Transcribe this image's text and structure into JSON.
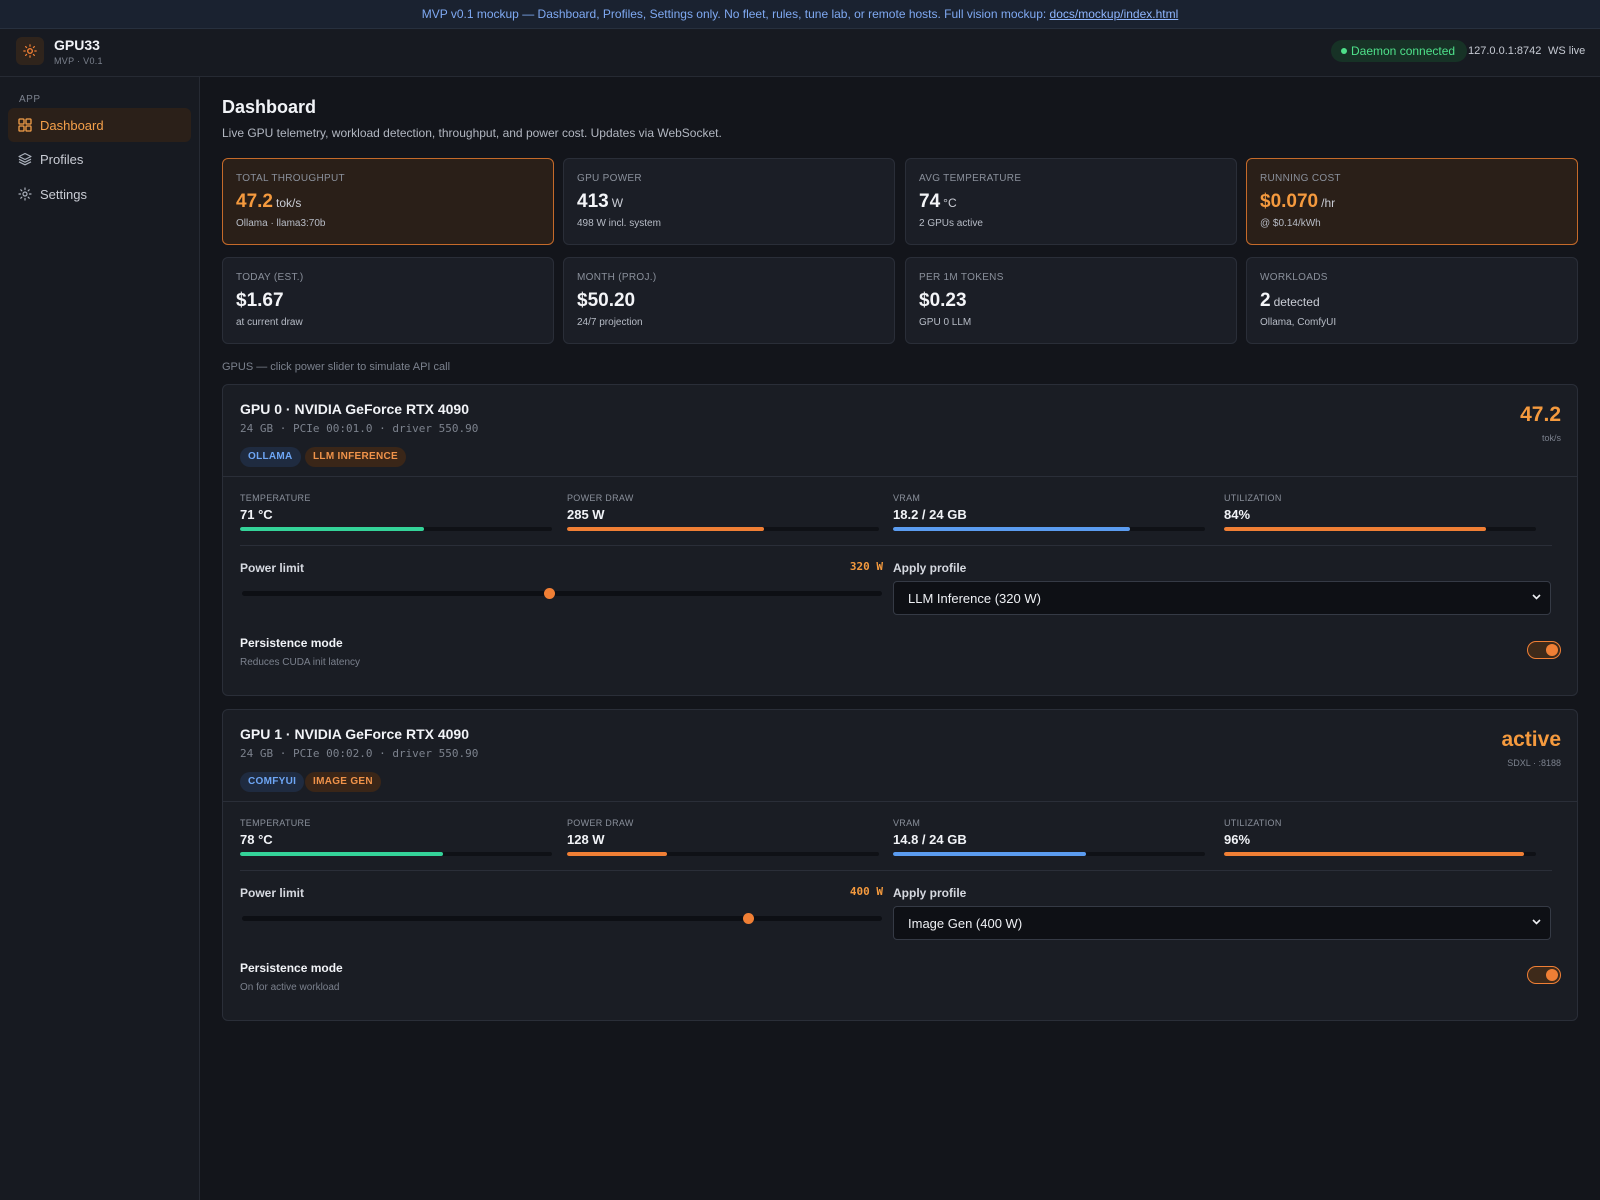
{
  "banner": {
    "text": "MVP v0.1 mockup — Dashboard, Profiles, Settings only. No fleet, rules, tune lab, or remote hosts. Full vision mockup: ",
    "link": "docs/mockup/index.html"
  },
  "header": {
    "app_name": "GPU33",
    "version": "MVP · V0.1",
    "daemon_status": "Daemon connected",
    "host": "127.0.0.1:8742",
    "ws": "WS live"
  },
  "sidebar": {
    "section": "APP",
    "items": [
      {
        "label": "Dashboard",
        "icon": "grid-icon",
        "active": true
      },
      {
        "label": "Profiles",
        "icon": "layers-icon",
        "active": false
      },
      {
        "label": "Settings",
        "icon": "gear-icon",
        "active": false
      }
    ]
  },
  "page": {
    "title": "Dashboard",
    "subtitle": "Live GPU telemetry, workload detection, throughput, and power cost. Updates via WebSocket."
  },
  "stats": [
    {
      "label": "TOTAL THROUGHPUT",
      "value": "47.2",
      "unit": "tok/s",
      "sub": "Ollama · llama3:70b",
      "highlight": true
    },
    {
      "label": "GPU POWER",
      "value": "413",
      "unit": "W",
      "sub": "498 W incl. system",
      "highlight": false
    },
    {
      "label": "AVG TEMPERATURE",
      "value": "74",
      "unit": "°C",
      "sub": "2 GPUs active",
      "highlight": false
    },
    {
      "label": "RUNNING COST",
      "value": "$0.070",
      "unit": "/hr",
      "sub": "@ $0.14/kWh",
      "highlight": true
    },
    {
      "label": "TODAY (EST.)",
      "value": "$1.67",
      "unit": "",
      "sub": "at current draw",
      "highlight": false
    },
    {
      "label": "MONTH (PROJ.)",
      "value": "$50.20",
      "unit": "",
      "sub": "24/7 projection",
      "highlight": false
    },
    {
      "label": "PER 1M TOKENS",
      "value": "$0.23",
      "unit": "",
      "sub": "GPU 0 LLM",
      "highlight": false
    },
    {
      "label": "WORKLOADS",
      "value": "2",
      "unit": "detected",
      "sub": "Ollama, ComfyUI",
      "highlight": false
    }
  ],
  "gpus_label": "GPUS — click power slider to simulate API call",
  "gpus": [
    {
      "name": "GPU 0 · NVIDIA GeForce RTX 4090",
      "meta": "24 GB · PCIe 00:01.0 · driver 550.90",
      "tags": [
        "OLLAMA",
        "LLM INFERENCE"
      ],
      "big": "47.2",
      "big_sub": "tok/s",
      "metrics": [
        {
          "label": "TEMPERATURE",
          "value": "71 °C",
          "fill": 0.59,
          "color": "#34d399"
        },
        {
          "label": "POWER DRAW",
          "value": "285 W",
          "fill": 0.63,
          "color": "#f07f35"
        },
        {
          "label": "VRAM",
          "value": "18.2 / 24 GB",
          "fill": 0.76,
          "color": "#5b9cf0"
        },
        {
          "label": "UTILIZATION",
          "value": "84%",
          "fill": 0.84,
          "color": "#f07f35"
        }
      ],
      "power_label": "Power limit",
      "power_value": "320 W",
      "power_fraction": 0.48,
      "profile_label": "Apply profile",
      "profile_value": "LLM Inference (320 W)",
      "persistence_label": "Persistence mode",
      "persistence_sub": "Reduces CUDA init latency",
      "persistence_on": true
    },
    {
      "name": "GPU 1 · NVIDIA GeForce RTX 4090",
      "meta": "24 GB · PCIe 00:02.0 · driver 550.90",
      "tags": [
        "COMFYUI",
        "IMAGE GEN"
      ],
      "big": "active",
      "big_sub": "SDXL · :8188",
      "metrics": [
        {
          "label": "TEMPERATURE",
          "value": "78 °C",
          "fill": 0.65,
          "color": "#34d399"
        },
        {
          "label": "POWER DRAW",
          "value": "128 W",
          "fill": 0.32,
          "color": "#f07f35"
        },
        {
          "label": "VRAM",
          "value": "14.8 / 24 GB",
          "fill": 0.62,
          "color": "#5b9cf0"
        },
        {
          "label": "UTILIZATION",
          "value": "96%",
          "fill": 0.96,
          "color": "#f07f35"
        }
      ],
      "power_label": "Power limit",
      "power_value": "400 W",
      "power_fraction": 0.79,
      "profile_label": "Apply profile",
      "profile_value": "Image Gen (400 W)",
      "persistence_label": "Persistence mode",
      "persistence_sub": "On for active workload",
      "persistence_on": true
    }
  ],
  "colors": {
    "accent": "#f59a3e",
    "success": "#4ee08a",
    "info": "#5b9cf0"
  }
}
